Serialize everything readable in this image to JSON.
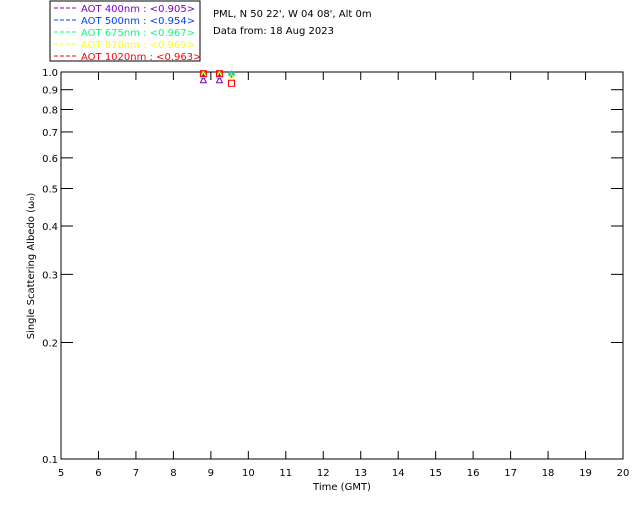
{
  "header": {
    "location": "PML, N 50 22', W 04 08', Alt 0m",
    "date": "Data from: 18 Aug 2023"
  },
  "legend": [
    {
      "label": "AOT  400nm : <0.905>",
      "color": "#7f00bf"
    },
    {
      "label": "AOT  500nm : <0.954>",
      "color": "#0040ff"
    },
    {
      "label": "AOT  675nm : <0.967>",
      "color": "#00ff80"
    },
    {
      "label": "AOT  870nm : <0.969>",
      "color": "#ffff00"
    },
    {
      "label": "AOT 1020nm : <0.963>",
      "color": "#ff0000"
    }
  ],
  "chart_data": {
    "type": "scatter",
    "xlabel": "Time (GMT)",
    "ylabel": "Single Scattering Albedo (ω₀)",
    "xlim": [
      5,
      20
    ],
    "ylim": [
      0.1,
      1.0
    ],
    "yscale": "log",
    "xticks": [
      "5",
      "6",
      "7",
      "8",
      "9",
      "10",
      "11",
      "12",
      "13",
      "14",
      "15",
      "16",
      "17",
      "18",
      "19",
      "20"
    ],
    "yticks": [
      {
        "v": 1.0,
        "l": "1.0"
      },
      {
        "v": 0.9,
        "l": "0.9"
      },
      {
        "v": 0.8,
        "l": "0.8"
      },
      {
        "v": 0.7,
        "l": "0.7"
      },
      {
        "v": 0.6,
        "l": "0.6"
      },
      {
        "v": 0.5,
        "l": "0.5"
      },
      {
        "v": 0.4,
        "l": "0.4"
      },
      {
        "v": 0.3,
        "l": "0.3"
      },
      {
        "v": 0.2,
        "l": "0.2"
      },
      {
        "v": 0.1,
        "l": "0.1"
      }
    ],
    "series": [
      {
        "name": "AOT  400nm",
        "color": "#7f00bf",
        "marker": "triangle",
        "x": [
          8.8,
          9.23
        ],
        "y": [
          0.955,
          0.955
        ]
      },
      {
        "name": "AOT  500nm",
        "color": "#0040ff",
        "marker": "asterisk",
        "x": [
          8.8,
          9.23,
          9.55
        ],
        "y": [
          0.975,
          0.975,
          0.99
        ]
      },
      {
        "name": "AOT  675nm",
        "color": "#00ff80",
        "marker": "diamond",
        "x": [
          8.8,
          9.23,
          9.55
        ],
        "y": [
          0.983,
          0.983,
          0.983
        ]
      },
      {
        "name": "AOT  870nm",
        "color": "#ffff00",
        "marker": "triangle",
        "x": [
          8.8,
          9.23,
          9.55
        ],
        "y": [
          0.985,
          0.985,
          0.972
        ]
      },
      {
        "name": "AOT 1020nm",
        "color": "#ff0000",
        "marker": "square",
        "x": [
          8.8,
          9.23,
          9.55
        ],
        "y": [
          0.99,
          0.99,
          0.935
        ]
      }
    ]
  }
}
